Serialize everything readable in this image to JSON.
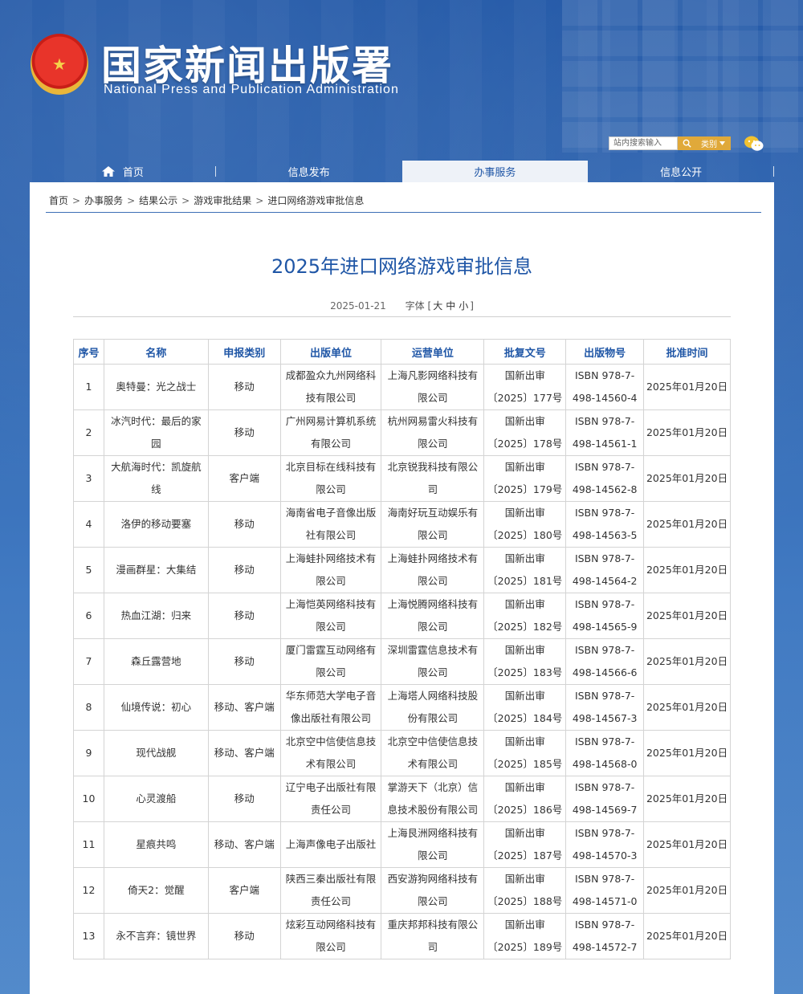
{
  "header": {
    "title": "国家新闻出版署",
    "subtitle": "National  Press and Publication Administration",
    "search_placeholder": "站内搜索输入",
    "category_label": "类别"
  },
  "nav": {
    "items": [
      {
        "label": "首页",
        "active": false
      },
      {
        "label": "信息发布",
        "active": false
      },
      {
        "label": "办事服务",
        "active": true
      },
      {
        "label": "信息公开",
        "active": false
      }
    ]
  },
  "breadcrumb": [
    "首页",
    "办事服务",
    "结果公示",
    "游戏审批结果",
    "进口网络游戏审批信息"
  ],
  "article": {
    "title": "2025年进口网络游戏审批信息",
    "date": "2025-01-21",
    "font_label": "字体",
    "font_open": "[",
    "font_large": "大",
    "font_medium": "中",
    "font_small": "小",
    "font_close": "]"
  },
  "table": {
    "headers": [
      "序号",
      "名称",
      "申报类别",
      "出版单位",
      "运营单位",
      "批复文号",
      "出版物号",
      "批准时间"
    ],
    "rows": [
      [
        "1",
        "奥特曼：光之战士",
        "移动",
        "成都盈众九州网络科技有限公司",
        "上海凡影网络科技有限公司",
        "国新出审〔2025〕177号",
        "ISBN 978-7-498-14560-4",
        "2025年01月20日"
      ],
      [
        "2",
        "冰汽时代：最后的家园",
        "移动",
        "广州网易计算机系统有限公司",
        "杭州网易雷火科技有限公司",
        "国新出审〔2025〕178号",
        "ISBN 978-7-498-14561-1",
        "2025年01月20日"
      ],
      [
        "3",
        "大航海时代：凯旋航线",
        "客户端",
        "北京目标在线科技有限公司",
        "北京锐我科技有限公司",
        "国新出审〔2025〕179号",
        "ISBN 978-7-498-14562-8",
        "2025年01月20日"
      ],
      [
        "4",
        "洛伊的移动要塞",
        "移动",
        "海南省电子音像出版社有限公司",
        "海南好玩互动娱乐有限公司",
        "国新出审〔2025〕180号",
        "ISBN 978-7-498-14563-5",
        "2025年01月20日"
      ],
      [
        "5",
        "漫画群星：大集结",
        "移动",
        "上海蛙扑网络技术有限公司",
        "上海蛙扑网络技术有限公司",
        "国新出审〔2025〕181号",
        "ISBN 978-7-498-14564-2",
        "2025年01月20日"
      ],
      [
        "6",
        "热血江湖：归来",
        "移动",
        "上海恺英网络科技有限公司",
        "上海悦腾网络科技有限公司",
        "国新出审〔2025〕182号",
        "ISBN 978-7-498-14565-9",
        "2025年01月20日"
      ],
      [
        "7",
        "森丘露营地",
        "移动",
        "厦门雷霆互动网络有限公司",
        "深圳雷霆信息技术有限公司",
        "国新出审〔2025〕183号",
        "ISBN 978-7-498-14566-6",
        "2025年01月20日"
      ],
      [
        "8",
        "仙境传说：初心",
        "移动、客户端",
        "华东师范大学电子音像出版社有限公司",
        "上海塔人网络科技股份有限公司",
        "国新出审〔2025〕184号",
        "ISBN 978-7-498-14567-3",
        "2025年01月20日"
      ],
      [
        "9",
        "现代战舰",
        "移动、客户端",
        "北京空中信使信息技术有限公司",
        "北京空中信使信息技术有限公司",
        "国新出审〔2025〕185号",
        "ISBN 978-7-498-14568-0",
        "2025年01月20日"
      ],
      [
        "10",
        "心灵渡船",
        "移动",
        "辽宁电子出版社有限责任公司",
        "掌游天下（北京）信息技术股份有限公司",
        "国新出审〔2025〕186号",
        "ISBN 978-7-498-14569-7",
        "2025年01月20日"
      ],
      [
        "11",
        "星痕共鸣",
        "移动、客户端",
        "上海声像电子出版社",
        "上海艮洲网络科技有限公司",
        "国新出审〔2025〕187号",
        "ISBN 978-7-498-14570-3",
        "2025年01月20日"
      ],
      [
        "12",
        "倚天2：觉醒",
        "客户端",
        "陕西三秦出版社有限责任公司",
        "西安游狗网络科技有限公司",
        "国新出审〔2025〕188号",
        "ISBN 978-7-498-14571-0",
        "2025年01月20日"
      ],
      [
        "13",
        "永不言弃：镜世界",
        "移动",
        "炫彩互动网络科技有限公司",
        "重庆邦邦科技有限公司",
        "国新出审〔2025〕189号",
        "ISBN 978-7-498-14572-7",
        "2025年01月20日"
      ]
    ]
  },
  "colors": {
    "brand_blue": "#1f56a6",
    "accent_gold": "#e0a93a"
  },
  "icons": [
    "national-emblem-icon",
    "search-icon",
    "chevron-down-icon",
    "wechat-icon",
    "home-icon"
  ]
}
